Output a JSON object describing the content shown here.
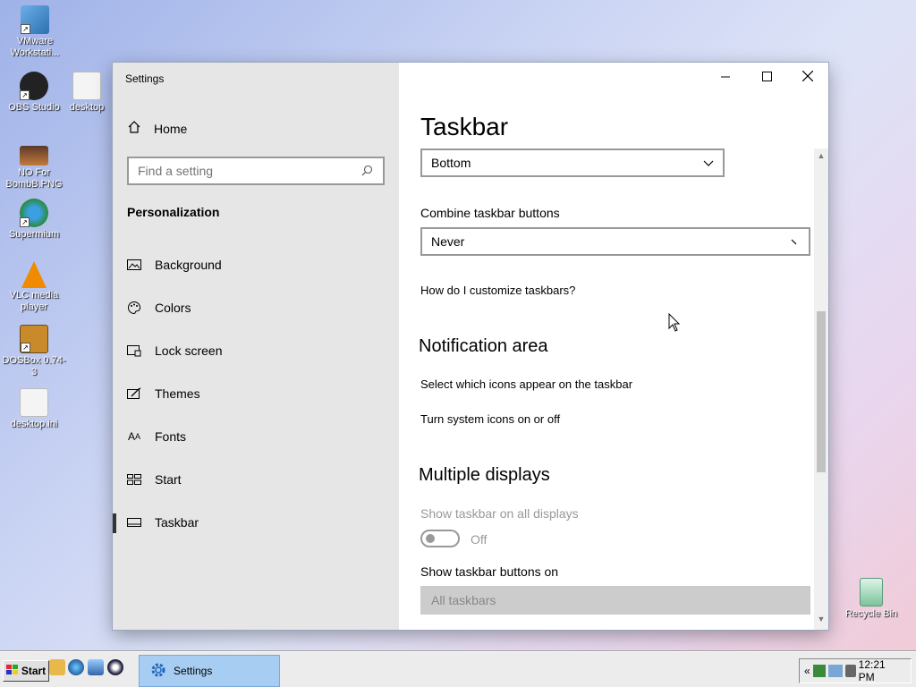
{
  "desktop": {
    "icons": [
      {
        "label": "VMware Workstati...",
        "icon": "vmware-icon"
      },
      {
        "label": "OBS Studio",
        "icon": "obs-icon"
      },
      {
        "label": "desktop",
        "icon": "file-icon"
      },
      {
        "label": "NO For BombB.PNG",
        "icon": "image-icon"
      },
      {
        "label": "Supermium",
        "icon": "browser-icon"
      },
      {
        "label": "VLC media player",
        "icon": "vlc-icon"
      },
      {
        "label": "DOSBox 0.74-3",
        "icon": "dosbox-icon"
      },
      {
        "label": "desktop.ini",
        "icon": "file-icon"
      },
      {
        "label": "Recycle Bin",
        "icon": "recycle-bin-icon"
      }
    ]
  },
  "window": {
    "title": "Settings",
    "nav": {
      "home": "Home",
      "search_placeholder": "Find a setting",
      "section": "Personalization",
      "items": [
        {
          "label": "Background",
          "icon": "picture-icon"
        },
        {
          "label": "Colors",
          "icon": "palette-icon"
        },
        {
          "label": "Lock screen",
          "icon": "lock-screen-icon"
        },
        {
          "label": "Themes",
          "icon": "themes-icon"
        },
        {
          "label": "Fonts",
          "icon": "fonts-icon"
        },
        {
          "label": "Start",
          "icon": "start-icon"
        },
        {
          "label": "Taskbar",
          "icon": "taskbar-icon",
          "active": true
        }
      ]
    },
    "content": {
      "title": "Taskbar",
      "location_value": "Bottom",
      "combine_label": "Combine taskbar buttons",
      "combine_value": "Never",
      "customize_link": "How do I customize taskbars?",
      "notification_heading": "Notification area",
      "notif_link1": "Select which icons appear on the taskbar",
      "notif_link2": "Turn system icons on or off",
      "multi_heading": "Multiple displays",
      "show_all_label": "Show taskbar on all displays",
      "toggle_state": "Off",
      "show_buttons_label": "Show taskbar buttons on",
      "show_buttons_value": "All taskbars"
    }
  },
  "taskbar": {
    "start_label": "Start",
    "task_label": "Settings",
    "tray_expand": "«",
    "clock": "12:21 PM"
  },
  "colors": {
    "nav_bg": "#e6e6e6",
    "task_active": "#a8cdf2"
  }
}
